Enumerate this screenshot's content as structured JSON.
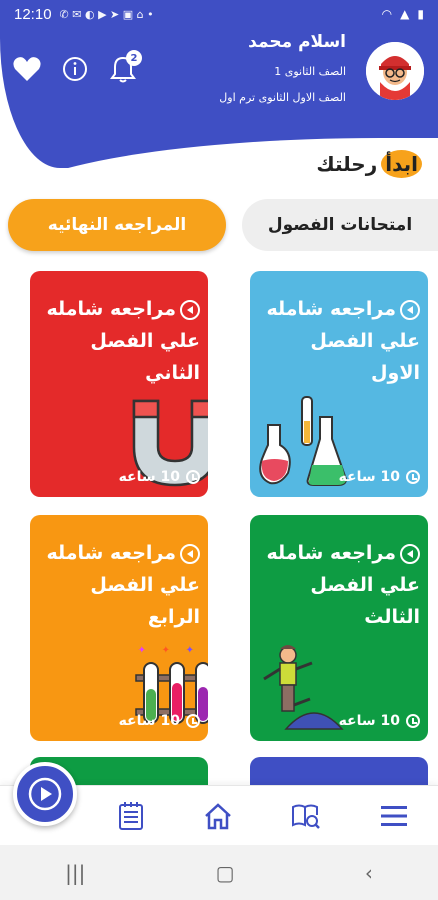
{
  "status_bar": {
    "time": "12:10",
    "icons": [
      "whatsapp-icon",
      "messenger-icon",
      "vpn-icon",
      "youtube-icon",
      "telegram-icon",
      "image-icon",
      "shop-icon",
      "more-icon"
    ]
  },
  "header": {
    "user_name": "اسلام محمد",
    "grade": "الصف الثانوى 1",
    "term": "الصف الاول الثانوى ترم اول",
    "notification_count": "2",
    "accent": "#3f4fc4"
  },
  "section_title": {
    "highlight": "ابدأ",
    "rest": "رحلتك"
  },
  "tabs": [
    {
      "label": "امتحانات الفصول",
      "active": false
    },
    {
      "label": "المراجعه النهائيه",
      "active": true,
      "color": "#f7a21b"
    }
  ],
  "cards": [
    {
      "title": "مراجعه شامله علي الفصل الاول",
      "duration": "10 ساعه",
      "color": "#55b8e2",
      "icon": "flasks-icon"
    },
    {
      "title": "مراجعه شامله علي الفصل الثاني",
      "duration": "10 ساعه",
      "color": "#e42a2a",
      "icon": "magnet-icon"
    },
    {
      "title": "مراجعه شامله علي الفصل الثالث",
      "duration": "10 ساعه",
      "color": "#0e9c43",
      "icon": "balance-icon"
    },
    {
      "title": "مراجعه شامله علي الفصل الرابع",
      "duration": "10 ساعه",
      "color": "#f89712",
      "icon": "test-tubes-icon"
    }
  ],
  "bottom_nav": [
    "notes-icon",
    "home-icon",
    "search-book-icon",
    "menu-icon"
  ]
}
